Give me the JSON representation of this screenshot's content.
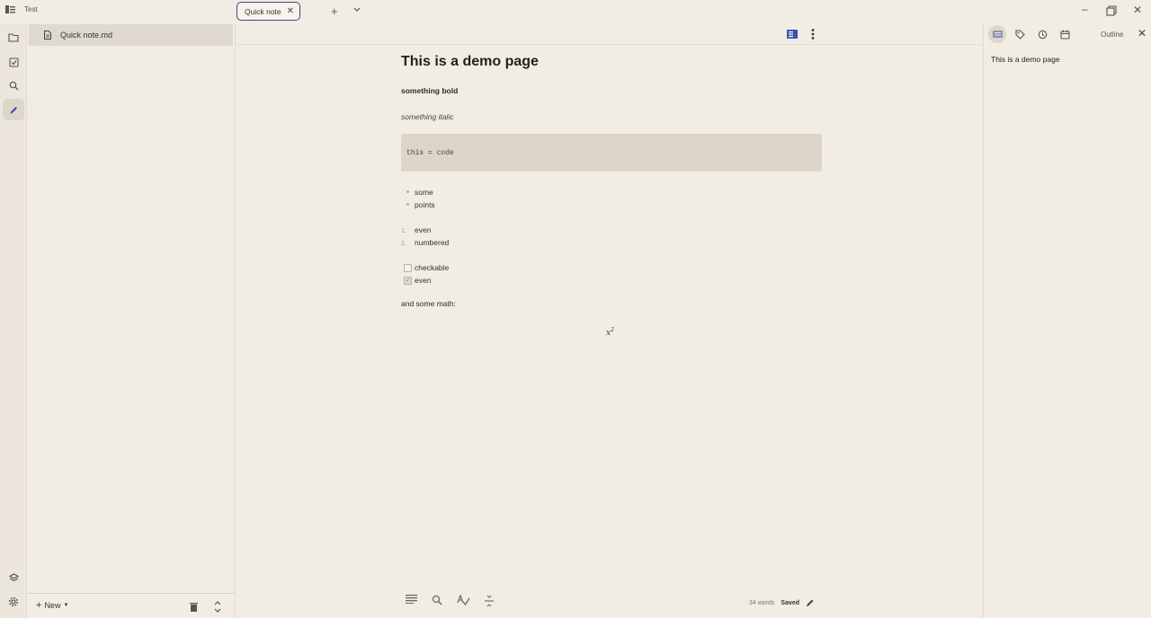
{
  "app": {
    "workspace_name": "Test"
  },
  "tabs": [
    {
      "label": "Quick note",
      "close": "✕"
    }
  ],
  "tab_actions": {
    "new_tab": "+",
    "close_window": "✕",
    "minimize": "–"
  },
  "sidebar": {
    "files": [
      {
        "label": "Quick note.md"
      }
    ],
    "new_label": "New"
  },
  "document": {
    "heading": "This is a demo page",
    "bold_text": "something bold",
    "italic_text": "something italic",
    "code_text": "this = code",
    "bullets": [
      "some",
      "points"
    ],
    "numbered": [
      {
        "num": "1.",
        "text": "even"
      },
      {
        "num": "2.",
        "text": "numbered"
      }
    ],
    "checklist": [
      {
        "checked": false,
        "text": "checkable"
      },
      {
        "checked": true,
        "text": "even"
      }
    ],
    "math_intro": "and some math:",
    "math_base": "x",
    "math_exp": "2"
  },
  "status": {
    "words": "34 words",
    "saved": "Saved"
  },
  "right_panel": {
    "title": "Outline",
    "outline_items": [
      "This is a demo page"
    ]
  },
  "icons": {
    "rail": [
      "folder-icon",
      "tasks-icon",
      "search-icon",
      "pen-icon",
      "layers-icon",
      "settings-icon"
    ],
    "toolbar": [
      "outline-toggle-icon",
      "more-vertical-icon"
    ],
    "bottom": [
      "list-icon",
      "search-icon",
      "spellcheck-icon",
      "divider-icon"
    ],
    "right_tabs": [
      "outline-icon",
      "tag-icon",
      "history-icon",
      "calendar-icon"
    ]
  },
  "colors": {
    "accent": "#3a4fb0",
    "background": "#f1ece4",
    "selected": "#dfd9d1"
  }
}
